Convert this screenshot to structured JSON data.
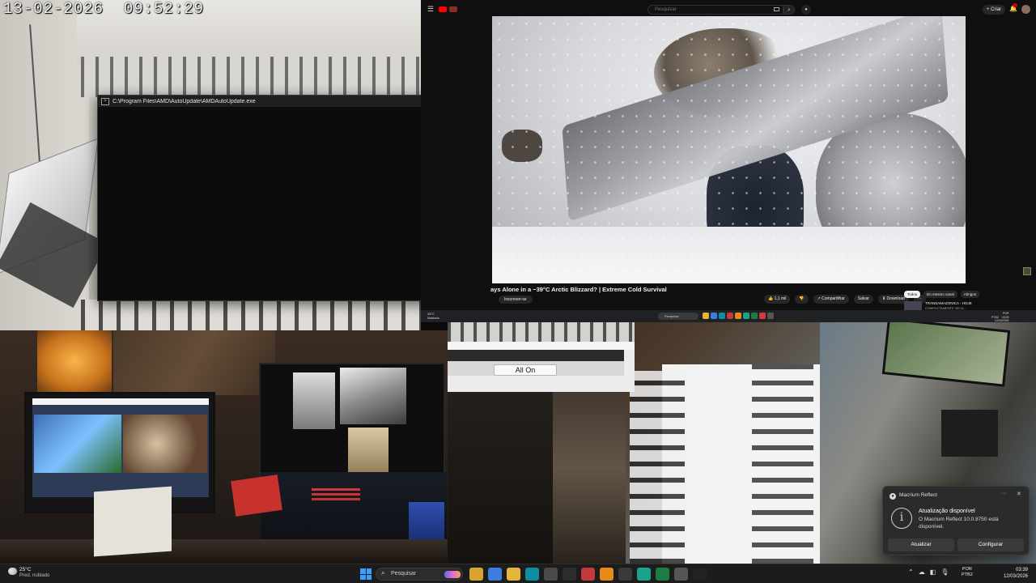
{
  "camera_top_left": {
    "timestamp": "13-02-2026  09:52:29"
  },
  "console_window": {
    "title": "C:\\Program Files\\AMD\\AutoUpdate\\AMDAutoUpdate.exe",
    "icon": "console-icon",
    "controls": {
      "minimize": "—",
      "maximize": "☐",
      "close": "✕"
    }
  },
  "browser": {
    "search_placeholder": "Pesquisar",
    "create_label": "+ Criar",
    "video_title": "ays Alone in a −39°C Arctic Blizzard? | Extreme Cold Survival",
    "subscribe_label": "Inscrever-se",
    "actions": [
      {
        "label": "👍 1,1 mil"
      },
      {
        "label": "👎"
      },
      {
        "label": "↗ Compartilhar"
      },
      {
        "label": "Salvar"
      },
      {
        "label": "⬇ Download"
      },
      {
        "label": "···"
      }
    ],
    "chips": [
      {
        "label": "Todos",
        "active": true
      },
      {
        "label": "Do mesmo canal",
        "active": false
      },
      {
        "label": "Abrigos",
        "active": false
      }
    ],
    "side_title": "TRANSAMAZONICA - HOJE",
    "side_sub": "COMPLETAMENTE SECA..."
  },
  "inner_taskbar": {
    "weather": "26°C\nNublado",
    "search": "Pesquisar",
    "tray": "POR\nPTB2    03:39\n    12/03/2026"
  },
  "ui_fragment": {
    "all_on_label": "All On"
  },
  "toast": {
    "app_name": "Macrium Reflect",
    "title": "Atualização disponível",
    "body": "O Macrium Reflect 10.0.8750 está disponível.",
    "button_primary": "Atualizar",
    "button_secondary": "Configurar",
    "more": "···",
    "close": "✕"
  },
  "taskbar": {
    "temperature": "25°C",
    "condition": "Pred. nublado",
    "search_label": "Pesquisar",
    "lang_line1": "POR",
    "lang_line2": "PTB2",
    "time": "03:39",
    "date": "12/03/2026",
    "apps": [
      {
        "name": "file-explorer-icon",
        "color": "#d7a52e"
      },
      {
        "name": "chrome-icon",
        "color": "#3b7ee0"
      },
      {
        "name": "folder-icon",
        "color": "#e4b539"
      },
      {
        "name": "edge-icon",
        "color": "#0e8ea1"
      },
      {
        "name": "calendar-icon",
        "color": "#4a4a4a"
      },
      {
        "name": "obs-icon",
        "color": "#2c2c2c"
      },
      {
        "name": "app-red-icon",
        "color": "#c33a3a"
      },
      {
        "name": "vlc-icon",
        "color": "#e88a1a"
      },
      {
        "name": "app-dark-icon",
        "color": "#3a3a3a"
      },
      {
        "name": "app-teal-icon",
        "color": "#1aa38a"
      },
      {
        "name": "excel-icon",
        "color": "#1f7a44"
      },
      {
        "name": "app-gray-icon",
        "color": "#555555"
      },
      {
        "name": "terminal-icon",
        "color": "#222222"
      }
    ]
  }
}
